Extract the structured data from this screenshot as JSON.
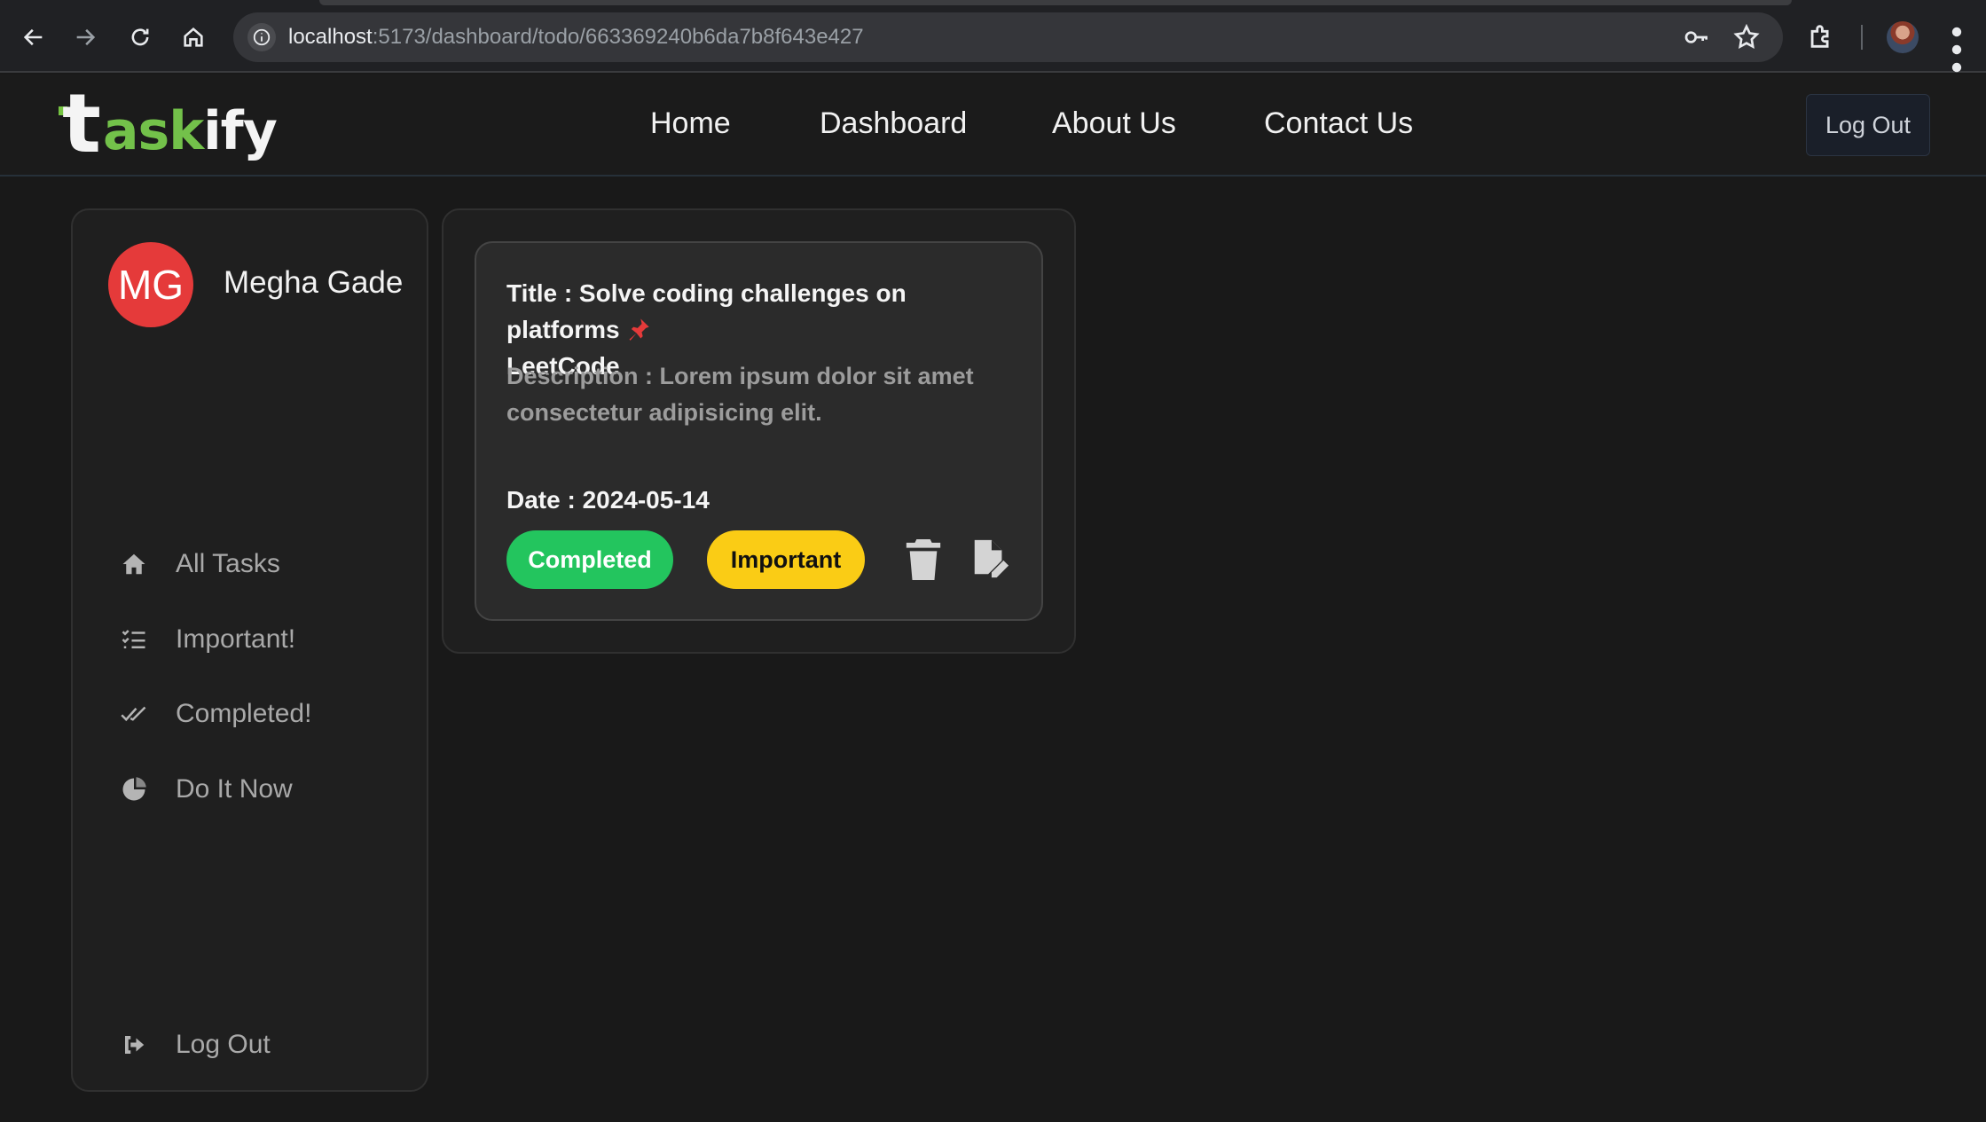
{
  "browser": {
    "url_host": "localhost",
    "url_path": ":5173/dashboard/todo/663369240b6da7b8f643e427"
  },
  "header": {
    "logo": {
      "first": "t",
      "accent": "ask",
      "tail": "ify"
    },
    "nav": [
      {
        "label": "Home"
      },
      {
        "label": "Dashboard"
      },
      {
        "label": "About Us"
      },
      {
        "label": "Contact Us"
      }
    ],
    "logout_label": "Log Out"
  },
  "sidebar": {
    "avatar_initials": "MG",
    "avatar_color": "#e53a3a",
    "user_name": "Megha Gade",
    "items": [
      {
        "label": "All Tasks",
        "icon": "home-icon"
      },
      {
        "label": "Important!",
        "icon": "list-check-icon"
      },
      {
        "label": "Completed!",
        "icon": "double-check-icon"
      },
      {
        "label": "Do It Now",
        "icon": "clock-pie-icon"
      }
    ],
    "logout_label": "Log Out"
  },
  "task": {
    "title": "Title : Solve coding challenges on platforms",
    "title_suffix": "LeetCode",
    "description": "Description : Lorem ipsum dolor sit amet consectetur adipisicing elit.",
    "date": "Date : 2024-05-14",
    "completed_label": "Completed",
    "important_label": "Important",
    "completed_color": "#23c55e",
    "important_color": "#facc15"
  }
}
